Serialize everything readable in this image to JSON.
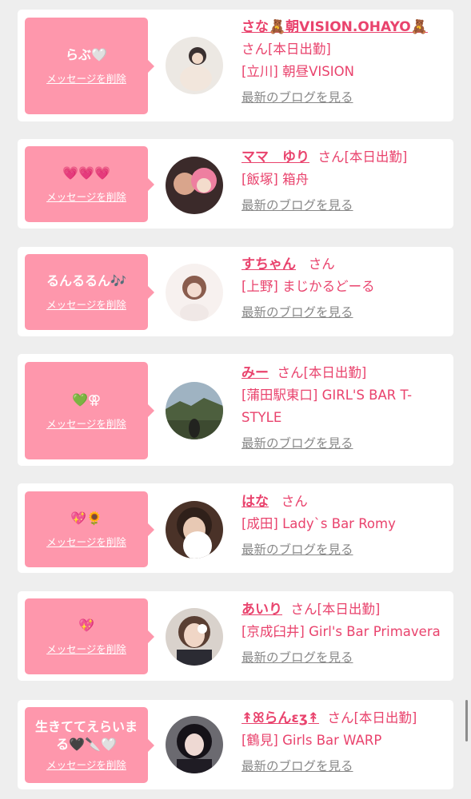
{
  "messages": [
    {
      "message": "らぶ🤍",
      "delete_label": "メッセージを削除",
      "name": "さな🧸朝VISION.OHAYO🧸",
      "suffix": "さん[本日出勤]",
      "shop": "[立川] 朝昼VISION",
      "blog_label": "最新のブログを見る"
    },
    {
      "message": "💗💗💗",
      "delete_label": "メッセージを削除",
      "name": "ママ　ゆり",
      "suffix": "さん[本日出勤]",
      "shop": "[飯塚] 箱舟",
      "blog_label": "最新のブログを見る"
    },
    {
      "message": "るんるるん🎶",
      "delete_label": "メッセージを削除",
      "name": "すちゃん",
      "suffix": "さん",
      "shop": "[上野] まじかるどーる",
      "blog_label": "最新のブログを見る"
    },
    {
      "message": "💚⚢",
      "delete_label": "メッセージを削除",
      "name": "みー",
      "suffix": "さん[本日出勤]",
      "shop": "[蒲田駅東口] GIRL'S BAR T-STYLE",
      "blog_label": "最新のブログを見る"
    },
    {
      "message": "💖🌻",
      "delete_label": "メッセージを削除",
      "name": "はな",
      "suffix": "さん",
      "shop": "[成田] Lady`s Bar Romy",
      "blog_label": "最新のブログを見る"
    },
    {
      "message": "💖",
      "delete_label": "メッセージを削除",
      "name": "あいり",
      "suffix": "さん[本日出勤]",
      "shop": "[京成臼井] Girl's Bar Primavera",
      "blog_label": "最新のブログを見る"
    },
    {
      "message": "生きててえらいまる🖤🔪🤍",
      "delete_label": "メッセージを削除",
      "name": "↟ꕤらんεʒ↟",
      "suffix": "さん[本日出勤]",
      "shop": "[鶴見] Girls Bar WARP",
      "blog_label": "最新のブログを見る"
    }
  ],
  "colors": {
    "bubble": "#fe97ac",
    "accent": "#e9436d",
    "link_gray": "#888888",
    "page_bg": "#eeeeee"
  }
}
